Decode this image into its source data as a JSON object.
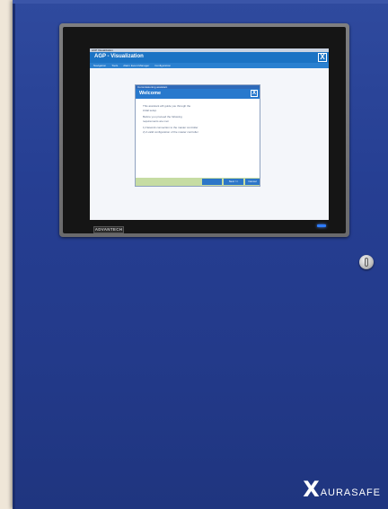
{
  "app": {
    "window_title": "ACP Visualization",
    "header_title": "AGP - Visualization",
    "close_glyph": "X",
    "menu": [
      "Navigation",
      "Tools",
      "Alarm Event Manager",
      "Configuration"
    ]
  },
  "dialog": {
    "window_title": "Commissioning assistant",
    "title": "Welcome",
    "close_glyph": "X",
    "body_lines": [
      "This assistant will guide you through the",
      "initial setup.",
      "Before you proceed the following",
      "requirements are met:",
      "1) Network connection to the master controller",
      "2) A valid configuration of the master controller"
    ],
    "buttons": {
      "back": "",
      "next": "Next >>",
      "cancel": "Cancel"
    }
  },
  "hardware": {
    "bezel_brand": "ADVANTECH",
    "logo_x": "X",
    "logo_text": "AURASAFE",
    "led_color": "#2e7cff"
  },
  "colors": {
    "cabinet_blue": "#263f93",
    "screen_header_blue": "#1b73c4",
    "dialog_footer_green": "#c6dca3"
  }
}
